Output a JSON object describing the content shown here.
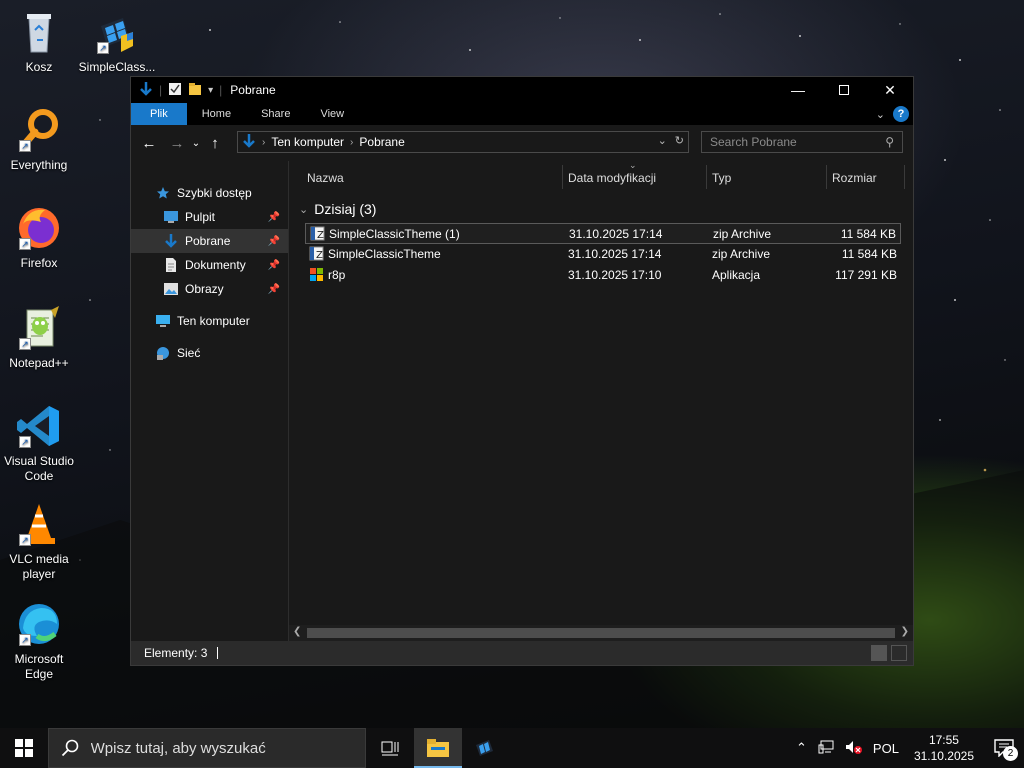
{
  "desktop": {
    "icons": [
      {
        "label": "Kosz",
        "icon": "recycle-bin-icon"
      },
      {
        "label": "SimpleClass...",
        "icon": "simpleclassic-icon"
      },
      {
        "label": "Everything",
        "icon": "everything-icon"
      },
      {
        "label": "Firefox",
        "icon": "firefox-icon"
      },
      {
        "label": "Notepad++",
        "icon": "notepadpp-icon"
      },
      {
        "label": "Visual Studio Code",
        "icon": "vscode-icon"
      },
      {
        "label": "VLC media player",
        "icon": "vlc-icon"
      },
      {
        "label": "Microsoft Edge",
        "icon": "edge-icon"
      }
    ]
  },
  "explorer": {
    "title": "Pobrane",
    "ribbon_tabs": [
      "Plik",
      "Home",
      "Share",
      "View"
    ],
    "address": {
      "segments": [
        "Ten komputer",
        "Pobrane"
      ]
    },
    "search": {
      "placeholder": "Search Pobrane"
    },
    "nav_pane": {
      "quick_access": "Szybki dostęp",
      "items": [
        {
          "label": "Pulpit",
          "icon": "desktop-folder-icon",
          "pinned": true
        },
        {
          "label": "Pobrane",
          "icon": "downloads-icon",
          "pinned": true,
          "selected": true
        },
        {
          "label": "Dokumenty",
          "icon": "documents-icon",
          "pinned": true
        },
        {
          "label": "Obrazy",
          "icon": "pictures-icon",
          "pinned": true
        }
      ],
      "this_pc": "Ten komputer",
      "network": "Sieć"
    },
    "columns": [
      "Nazwa",
      "Data modyfikacji",
      "Typ",
      "Rozmiar"
    ],
    "group": {
      "label": "Dzisiaj (3)"
    },
    "files": [
      {
        "name": "SimpleClassicTheme (1)",
        "date": "31.10.2025 17:14",
        "type": "zip Archive",
        "size": "11 584 KB",
        "icon": "zip-icon",
        "selected": true
      },
      {
        "name": "SimpleClassicTheme",
        "date": "31.10.2025 17:14",
        "type": "zip Archive",
        "size": "11 584 KB",
        "icon": "zip-icon",
        "selected": false
      },
      {
        "name": "r8p",
        "date": "31.10.2025 17:10",
        "type": "Aplikacja",
        "size": "117 291 KB",
        "icon": "app-icon",
        "selected": false
      }
    ],
    "status": {
      "items": "Elementy: 3"
    }
  },
  "taskbar": {
    "search_placeholder": "Wpisz tutaj, aby wyszukać",
    "language": "POL",
    "time": "17:55",
    "date": "31.10.2025",
    "notification_count": "2"
  },
  "colors": {
    "accent": "#1979ca",
    "window_bg": "#191919",
    "taskbar_bg": "#0f0f10"
  }
}
